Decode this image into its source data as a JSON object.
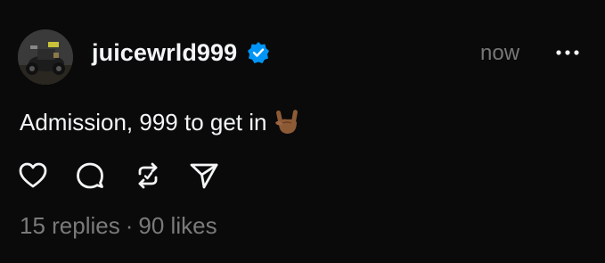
{
  "post": {
    "username": "juicewrld999",
    "timestamp": "now",
    "caption": "Admission, 999 to get in",
    "replies": "15 replies",
    "separator": "·",
    "likes": "90 likes"
  },
  "icons": {
    "verified": "verified-badge-icon",
    "more": "more-dots-icon",
    "emoji": "rock-on-hand-emoji",
    "like": "heart-icon",
    "reply": "comment-bubble-icon",
    "repost": "repost-icon",
    "share": "send-icon"
  },
  "colors": {
    "background": "#0a0a0a",
    "text": "#f3f5f7",
    "muted": "#777777",
    "verified": "#0095f6"
  }
}
